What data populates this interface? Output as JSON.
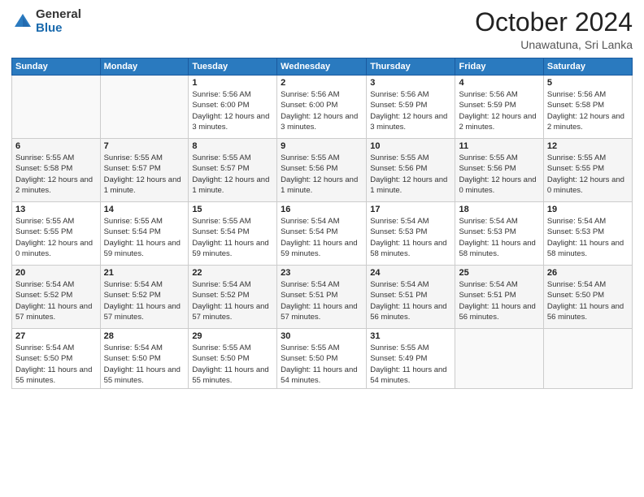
{
  "logo": {
    "general": "General",
    "blue": "Blue"
  },
  "title": "October 2024",
  "location": "Unawatuna, Sri Lanka",
  "headers": [
    "Sunday",
    "Monday",
    "Tuesday",
    "Wednesday",
    "Thursday",
    "Friday",
    "Saturday"
  ],
  "weeks": [
    [
      {
        "day": "",
        "info": ""
      },
      {
        "day": "",
        "info": ""
      },
      {
        "day": "1",
        "info": "Sunrise: 5:56 AM\nSunset: 6:00 PM\nDaylight: 12 hours and 3 minutes."
      },
      {
        "day": "2",
        "info": "Sunrise: 5:56 AM\nSunset: 6:00 PM\nDaylight: 12 hours and 3 minutes."
      },
      {
        "day": "3",
        "info": "Sunrise: 5:56 AM\nSunset: 5:59 PM\nDaylight: 12 hours and 3 minutes."
      },
      {
        "day": "4",
        "info": "Sunrise: 5:56 AM\nSunset: 5:59 PM\nDaylight: 12 hours and 2 minutes."
      },
      {
        "day": "5",
        "info": "Sunrise: 5:56 AM\nSunset: 5:58 PM\nDaylight: 12 hours and 2 minutes."
      }
    ],
    [
      {
        "day": "6",
        "info": "Sunrise: 5:55 AM\nSunset: 5:58 PM\nDaylight: 12 hours and 2 minutes."
      },
      {
        "day": "7",
        "info": "Sunrise: 5:55 AM\nSunset: 5:57 PM\nDaylight: 12 hours and 1 minute."
      },
      {
        "day": "8",
        "info": "Sunrise: 5:55 AM\nSunset: 5:57 PM\nDaylight: 12 hours and 1 minute."
      },
      {
        "day": "9",
        "info": "Sunrise: 5:55 AM\nSunset: 5:56 PM\nDaylight: 12 hours and 1 minute."
      },
      {
        "day": "10",
        "info": "Sunrise: 5:55 AM\nSunset: 5:56 PM\nDaylight: 12 hours and 1 minute."
      },
      {
        "day": "11",
        "info": "Sunrise: 5:55 AM\nSunset: 5:56 PM\nDaylight: 12 hours and 0 minutes."
      },
      {
        "day": "12",
        "info": "Sunrise: 5:55 AM\nSunset: 5:55 PM\nDaylight: 12 hours and 0 minutes."
      }
    ],
    [
      {
        "day": "13",
        "info": "Sunrise: 5:55 AM\nSunset: 5:55 PM\nDaylight: 12 hours and 0 minutes."
      },
      {
        "day": "14",
        "info": "Sunrise: 5:55 AM\nSunset: 5:54 PM\nDaylight: 11 hours and 59 minutes."
      },
      {
        "day": "15",
        "info": "Sunrise: 5:55 AM\nSunset: 5:54 PM\nDaylight: 11 hours and 59 minutes."
      },
      {
        "day": "16",
        "info": "Sunrise: 5:54 AM\nSunset: 5:54 PM\nDaylight: 11 hours and 59 minutes."
      },
      {
        "day": "17",
        "info": "Sunrise: 5:54 AM\nSunset: 5:53 PM\nDaylight: 11 hours and 58 minutes."
      },
      {
        "day": "18",
        "info": "Sunrise: 5:54 AM\nSunset: 5:53 PM\nDaylight: 11 hours and 58 minutes."
      },
      {
        "day": "19",
        "info": "Sunrise: 5:54 AM\nSunset: 5:53 PM\nDaylight: 11 hours and 58 minutes."
      }
    ],
    [
      {
        "day": "20",
        "info": "Sunrise: 5:54 AM\nSunset: 5:52 PM\nDaylight: 11 hours and 57 minutes."
      },
      {
        "day": "21",
        "info": "Sunrise: 5:54 AM\nSunset: 5:52 PM\nDaylight: 11 hours and 57 minutes."
      },
      {
        "day": "22",
        "info": "Sunrise: 5:54 AM\nSunset: 5:52 PM\nDaylight: 11 hours and 57 minutes."
      },
      {
        "day": "23",
        "info": "Sunrise: 5:54 AM\nSunset: 5:51 PM\nDaylight: 11 hours and 57 minutes."
      },
      {
        "day": "24",
        "info": "Sunrise: 5:54 AM\nSunset: 5:51 PM\nDaylight: 11 hours and 56 minutes."
      },
      {
        "day": "25",
        "info": "Sunrise: 5:54 AM\nSunset: 5:51 PM\nDaylight: 11 hours and 56 minutes."
      },
      {
        "day": "26",
        "info": "Sunrise: 5:54 AM\nSunset: 5:50 PM\nDaylight: 11 hours and 56 minutes."
      }
    ],
    [
      {
        "day": "27",
        "info": "Sunrise: 5:54 AM\nSunset: 5:50 PM\nDaylight: 11 hours and 55 minutes."
      },
      {
        "day": "28",
        "info": "Sunrise: 5:54 AM\nSunset: 5:50 PM\nDaylight: 11 hours and 55 minutes."
      },
      {
        "day": "29",
        "info": "Sunrise: 5:55 AM\nSunset: 5:50 PM\nDaylight: 11 hours and 55 minutes."
      },
      {
        "day": "30",
        "info": "Sunrise: 5:55 AM\nSunset: 5:50 PM\nDaylight: 11 hours and 54 minutes."
      },
      {
        "day": "31",
        "info": "Sunrise: 5:55 AM\nSunset: 5:49 PM\nDaylight: 11 hours and 54 minutes."
      },
      {
        "day": "",
        "info": ""
      },
      {
        "day": "",
        "info": ""
      }
    ]
  ]
}
